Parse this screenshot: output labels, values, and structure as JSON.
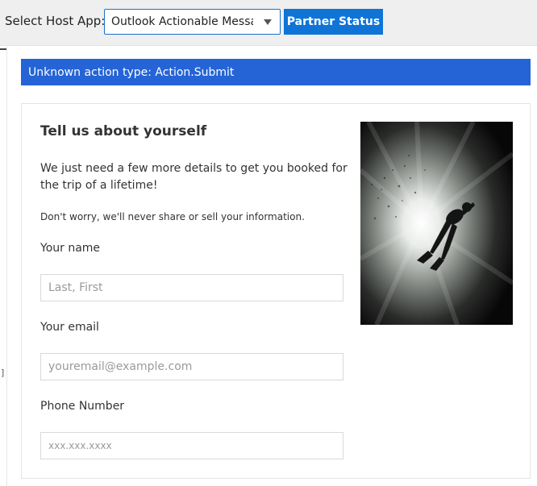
{
  "toolbar": {
    "host_label": "Select Host App:",
    "host_select_value": "Outlook Actionable Messages",
    "partner_button": "Partner Status"
  },
  "banner": {
    "text": "Unknown action type: Action.Submit"
  },
  "card": {
    "title": "Tell us about yourself",
    "description": "We just need a few more details to get you booked for the trip of a lifetime!",
    "note": "Don't worry, we'll never share or sell your information.",
    "fields": [
      {
        "label": "Your name",
        "placeholder": "Last, First",
        "value": ""
      },
      {
        "label": "Your email",
        "placeholder": "youremail@example.com",
        "value": ""
      },
      {
        "label": "Phone Number",
        "placeholder": "xxx.xxx.xxxx",
        "value": ""
      }
    ],
    "image_icon": "scuba-diver-photo"
  },
  "colors": {
    "accent": "#0f74d6",
    "banner": "#2464d6",
    "toolbar_bg": "#efefef",
    "select_border": "#1a73c9"
  }
}
